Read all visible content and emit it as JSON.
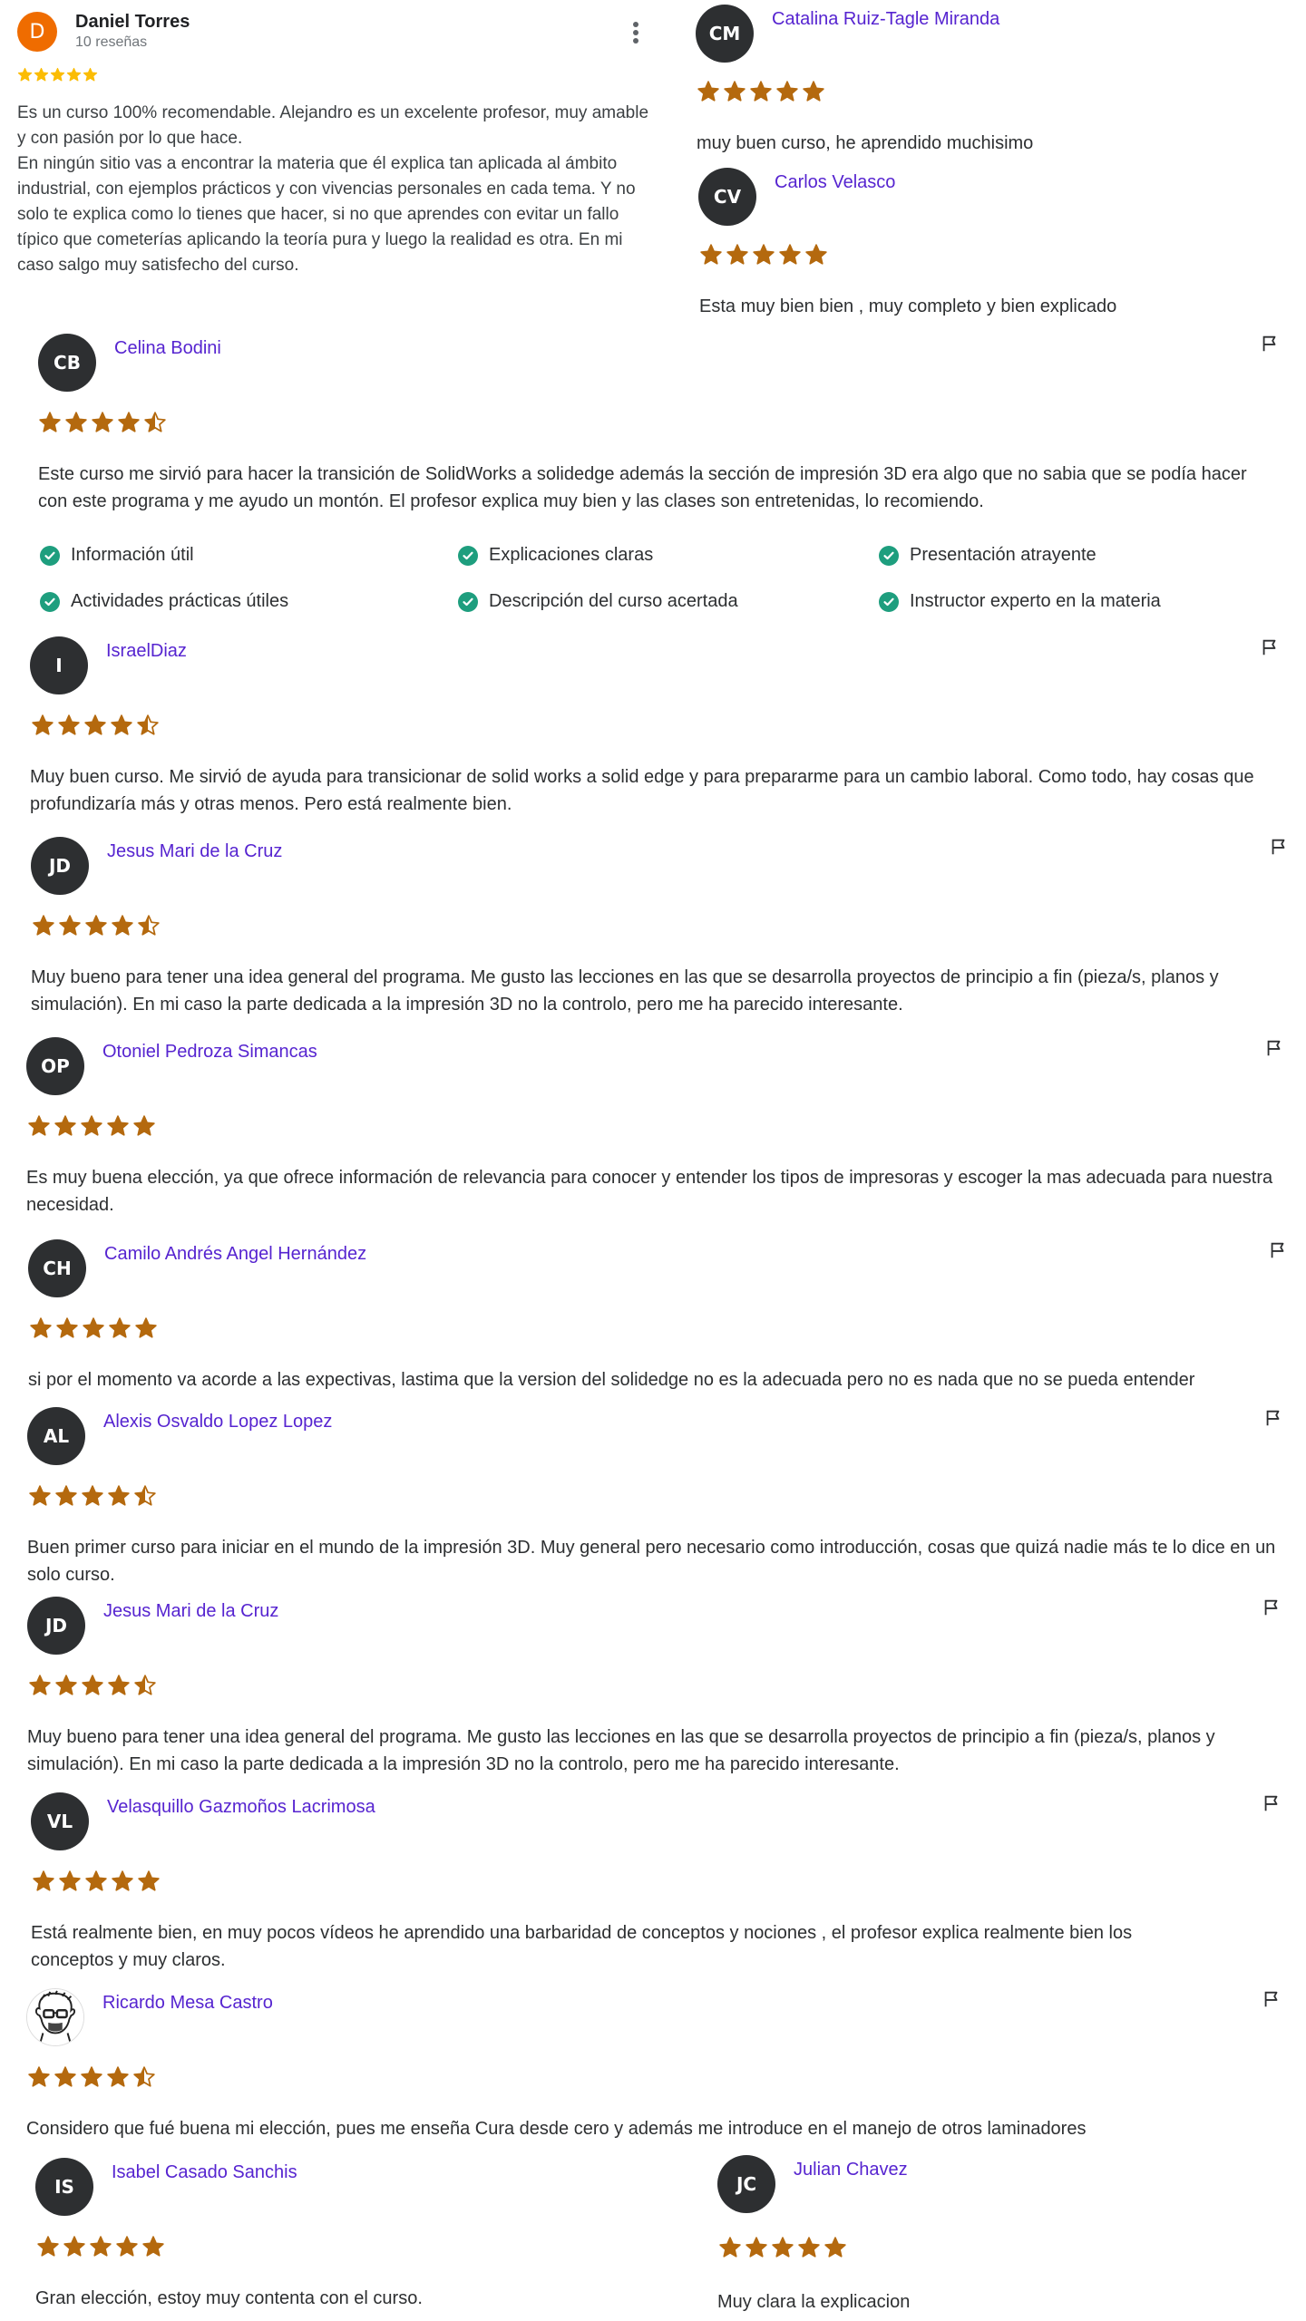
{
  "google_review": {
    "avatar_initial": "D",
    "name": "Daniel Torres",
    "count": "10 reseñas",
    "rating": 5,
    "text": "Es un curso 100% recomendable. Alejandro es un excelente profesor, muy amable y con pasión por lo que hace.\nEn ningún sitio vas a encontrar la materia que él explica tan aplicada al ámbito industrial, con ejemplos prácticos y con vivencias personales en cada tema. Y no solo te explica como lo tienes que hacer, si no que aprendes con evitar un fallo típico que cometerías aplicando la teoría pura y luego la realidad es otra. En mi caso salgo muy satisfecho del curso."
  },
  "reviews": [
    {
      "initials": "CM",
      "name": "Catalina Ruiz-Tagle Miranda",
      "rating": 5,
      "text": "muy buen curso, he aprendido muchisimo"
    },
    {
      "initials": "CV",
      "name": "Carlos Velasco",
      "rating": 5,
      "text": "Esta muy bien bien , muy completo y bien explicado"
    },
    {
      "initials": "CB",
      "name": "Celina Bodini",
      "rating": 4.5,
      "text": "Este curso me sirvió para hacer la transición de SolidWorks a solidedge además la sección de impresión 3D era algo que no sabia que se podía hacer con este programa y me ayudo un montón. El profesor explica muy bien y las clases son entretenidas, lo recomiendo."
    },
    {
      "initials": "I",
      "name": "IsraelDiaz",
      "rating": 4.5,
      "text": "Muy buen curso. Me sirvió de ayuda para transicionar de solid works a solid edge y para prepararme para un cambio laboral. Como todo, hay cosas que profundizaría más y otras menos. Pero está realmente bien."
    },
    {
      "initials": "JD",
      "name": "Jesus Mari de la Cruz",
      "rating": 4.5,
      "text": "Muy bueno para tener una idea general del programa. Me gusto las lecciones en las que se desarrolla proyectos de principio a fin (pieza/s, planos y simulación). En mi caso la parte dedicada a la impresión 3D no la controlo, pero me ha parecido interesante."
    },
    {
      "initials": "OP",
      "name": "Otoniel Pedroza Simancas",
      "rating": 5,
      "text": "Es muy buena elección, ya que ofrece información de relevancia para conocer y entender los tipos de impresoras y escoger la mas adecuada para nuestra necesidad."
    },
    {
      "initials": "CH",
      "name": "Camilo Andrés Angel Hernández",
      "rating": 5,
      "text": "si por el momento va acorde a las expectivas, lastima que la version del solidedge no es la adecuada pero no es nada que no se pueda entender"
    },
    {
      "initials": "AL",
      "name": "Alexis Osvaldo Lopez Lopez",
      "rating": 4.5,
      "text": "Buen primer curso para iniciar en el mundo de la impresión 3D. Muy general pero necesario como introducción, cosas que quizá nadie más te lo dice en un solo curso."
    },
    {
      "initials": "JD",
      "name": "Jesus Mari de la Cruz",
      "rating": 4.5,
      "text": "Muy bueno para tener una idea general del programa. Me gusto las lecciones en las que se desarrolla proyectos de principio a fin (pieza/s, planos y simulación). En mi caso la parte dedicada a la impresión 3D no la controlo, pero me ha parecido interesante."
    },
    {
      "initials": "VL",
      "name": "Velasquillo Gazmoños Lacrimosa",
      "rating": 5,
      "text": "Está realmente bien, en muy pocos vídeos he aprendido una barbaridad de conceptos y nociones , el profesor explica realmente bien los conceptos y muy claros."
    },
    {
      "initials": "",
      "name": "Ricardo Mesa Castro",
      "rating": 4.5,
      "text": "Considero que fué buena mi elección, pues me enseña Cura desde cero y además me introduce en el manejo de otros laminadores"
    },
    {
      "initials": "IS",
      "name": "Isabel Casado Sanchis",
      "rating": 5,
      "text": "Gran elección, estoy muy contenta con el curso."
    },
    {
      "initials": "JC",
      "name": "Julian Chavez",
      "rating": 5,
      "text": "Muy clara la explicacion"
    }
  ],
  "tags": [
    "Información útil",
    "Explicaciones claras",
    "Presentación atrayente",
    "Actividades prácticas útiles",
    "Descripción del curso acertada",
    "Instructor experto en la materia"
  ],
  "colors": {
    "star": "#b4690e",
    "google_star": "#fbbc04",
    "name": "#5624d0",
    "check": "#1e9e7e"
  }
}
